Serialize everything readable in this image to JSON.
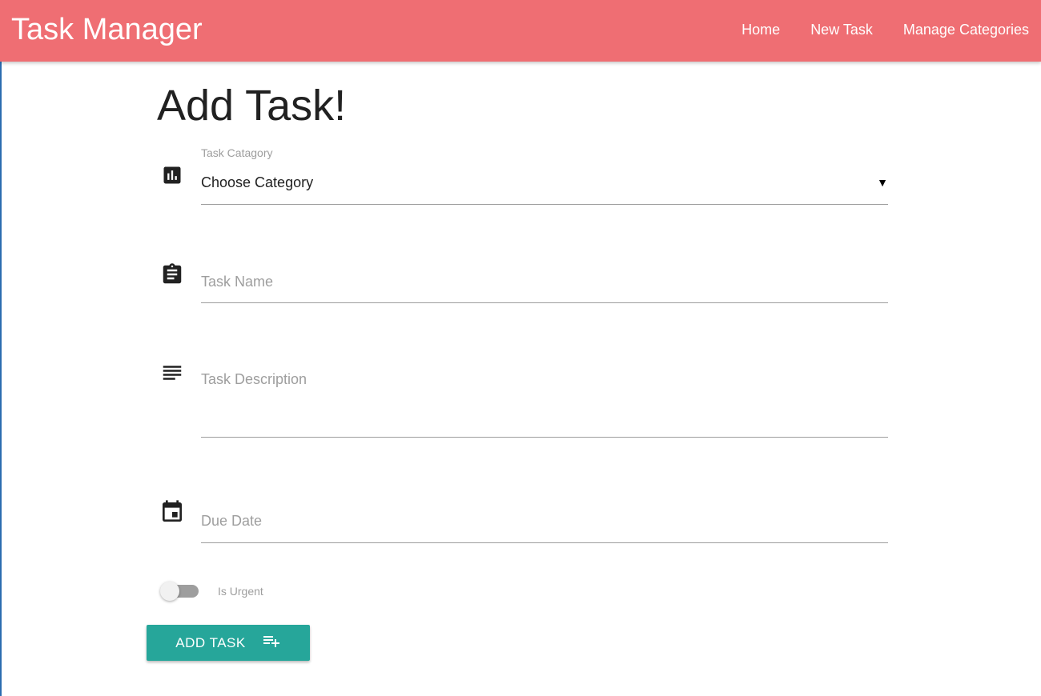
{
  "navbar": {
    "brand": "Task Manager",
    "links": [
      "Home",
      "New Task",
      "Manage Categories"
    ],
    "background_color": "#ef6e73"
  },
  "page": {
    "title": "Add Task!"
  },
  "form": {
    "category": {
      "label": "Task Catagory",
      "selected": "Choose Category",
      "icon": "bar-chart-icon"
    },
    "task_name": {
      "placeholder": "Task Name",
      "value": "",
      "icon": "assignment-icon"
    },
    "task_description": {
      "placeholder": "Task Description",
      "value": "",
      "icon": "notes-icon"
    },
    "due_date": {
      "placeholder": "Due Date",
      "value": "",
      "icon": "calendar-icon"
    },
    "urgent": {
      "label": "Is Urgent",
      "checked": false
    },
    "submit": {
      "label": "ADD TASK",
      "icon": "playlist-add-icon",
      "color": "#26a69a"
    }
  }
}
